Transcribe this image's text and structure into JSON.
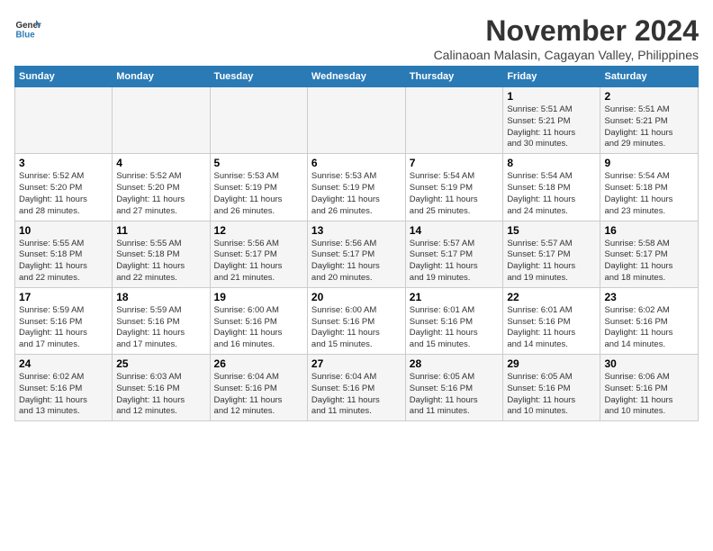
{
  "logo": {
    "line1": "General",
    "line2": "Blue"
  },
  "title": "November 2024",
  "location": "Calinaoan Malasin, Cagayan Valley, Philippines",
  "headers": [
    "Sunday",
    "Monday",
    "Tuesday",
    "Wednesday",
    "Thursday",
    "Friday",
    "Saturday"
  ],
  "weeks": [
    [
      {
        "day": "",
        "info": ""
      },
      {
        "day": "",
        "info": ""
      },
      {
        "day": "",
        "info": ""
      },
      {
        "day": "",
        "info": ""
      },
      {
        "day": "",
        "info": ""
      },
      {
        "day": "1",
        "info": "Sunrise: 5:51 AM\nSunset: 5:21 PM\nDaylight: 11 hours\nand 30 minutes."
      },
      {
        "day": "2",
        "info": "Sunrise: 5:51 AM\nSunset: 5:21 PM\nDaylight: 11 hours\nand 29 minutes."
      }
    ],
    [
      {
        "day": "3",
        "info": "Sunrise: 5:52 AM\nSunset: 5:20 PM\nDaylight: 11 hours\nand 28 minutes."
      },
      {
        "day": "4",
        "info": "Sunrise: 5:52 AM\nSunset: 5:20 PM\nDaylight: 11 hours\nand 27 minutes."
      },
      {
        "day": "5",
        "info": "Sunrise: 5:53 AM\nSunset: 5:19 PM\nDaylight: 11 hours\nand 26 minutes."
      },
      {
        "day": "6",
        "info": "Sunrise: 5:53 AM\nSunset: 5:19 PM\nDaylight: 11 hours\nand 26 minutes."
      },
      {
        "day": "7",
        "info": "Sunrise: 5:54 AM\nSunset: 5:19 PM\nDaylight: 11 hours\nand 25 minutes."
      },
      {
        "day": "8",
        "info": "Sunrise: 5:54 AM\nSunset: 5:18 PM\nDaylight: 11 hours\nand 24 minutes."
      },
      {
        "day": "9",
        "info": "Sunrise: 5:54 AM\nSunset: 5:18 PM\nDaylight: 11 hours\nand 23 minutes."
      }
    ],
    [
      {
        "day": "10",
        "info": "Sunrise: 5:55 AM\nSunset: 5:18 PM\nDaylight: 11 hours\nand 22 minutes."
      },
      {
        "day": "11",
        "info": "Sunrise: 5:55 AM\nSunset: 5:18 PM\nDaylight: 11 hours\nand 22 minutes."
      },
      {
        "day": "12",
        "info": "Sunrise: 5:56 AM\nSunset: 5:17 PM\nDaylight: 11 hours\nand 21 minutes."
      },
      {
        "day": "13",
        "info": "Sunrise: 5:56 AM\nSunset: 5:17 PM\nDaylight: 11 hours\nand 20 minutes."
      },
      {
        "day": "14",
        "info": "Sunrise: 5:57 AM\nSunset: 5:17 PM\nDaylight: 11 hours\nand 19 minutes."
      },
      {
        "day": "15",
        "info": "Sunrise: 5:57 AM\nSunset: 5:17 PM\nDaylight: 11 hours\nand 19 minutes."
      },
      {
        "day": "16",
        "info": "Sunrise: 5:58 AM\nSunset: 5:17 PM\nDaylight: 11 hours\nand 18 minutes."
      }
    ],
    [
      {
        "day": "17",
        "info": "Sunrise: 5:59 AM\nSunset: 5:16 PM\nDaylight: 11 hours\nand 17 minutes."
      },
      {
        "day": "18",
        "info": "Sunrise: 5:59 AM\nSunset: 5:16 PM\nDaylight: 11 hours\nand 17 minutes."
      },
      {
        "day": "19",
        "info": "Sunrise: 6:00 AM\nSunset: 5:16 PM\nDaylight: 11 hours\nand 16 minutes."
      },
      {
        "day": "20",
        "info": "Sunrise: 6:00 AM\nSunset: 5:16 PM\nDaylight: 11 hours\nand 15 minutes."
      },
      {
        "day": "21",
        "info": "Sunrise: 6:01 AM\nSunset: 5:16 PM\nDaylight: 11 hours\nand 15 minutes."
      },
      {
        "day": "22",
        "info": "Sunrise: 6:01 AM\nSunset: 5:16 PM\nDaylight: 11 hours\nand 14 minutes."
      },
      {
        "day": "23",
        "info": "Sunrise: 6:02 AM\nSunset: 5:16 PM\nDaylight: 11 hours\nand 14 minutes."
      }
    ],
    [
      {
        "day": "24",
        "info": "Sunrise: 6:02 AM\nSunset: 5:16 PM\nDaylight: 11 hours\nand 13 minutes."
      },
      {
        "day": "25",
        "info": "Sunrise: 6:03 AM\nSunset: 5:16 PM\nDaylight: 11 hours\nand 12 minutes."
      },
      {
        "day": "26",
        "info": "Sunrise: 6:04 AM\nSunset: 5:16 PM\nDaylight: 11 hours\nand 12 minutes."
      },
      {
        "day": "27",
        "info": "Sunrise: 6:04 AM\nSunset: 5:16 PM\nDaylight: 11 hours\nand 11 minutes."
      },
      {
        "day": "28",
        "info": "Sunrise: 6:05 AM\nSunset: 5:16 PM\nDaylight: 11 hours\nand 11 minutes."
      },
      {
        "day": "29",
        "info": "Sunrise: 6:05 AM\nSunset: 5:16 PM\nDaylight: 11 hours\nand 10 minutes."
      },
      {
        "day": "30",
        "info": "Sunrise: 6:06 AM\nSunset: 5:16 PM\nDaylight: 11 hours\nand 10 minutes."
      }
    ]
  ]
}
